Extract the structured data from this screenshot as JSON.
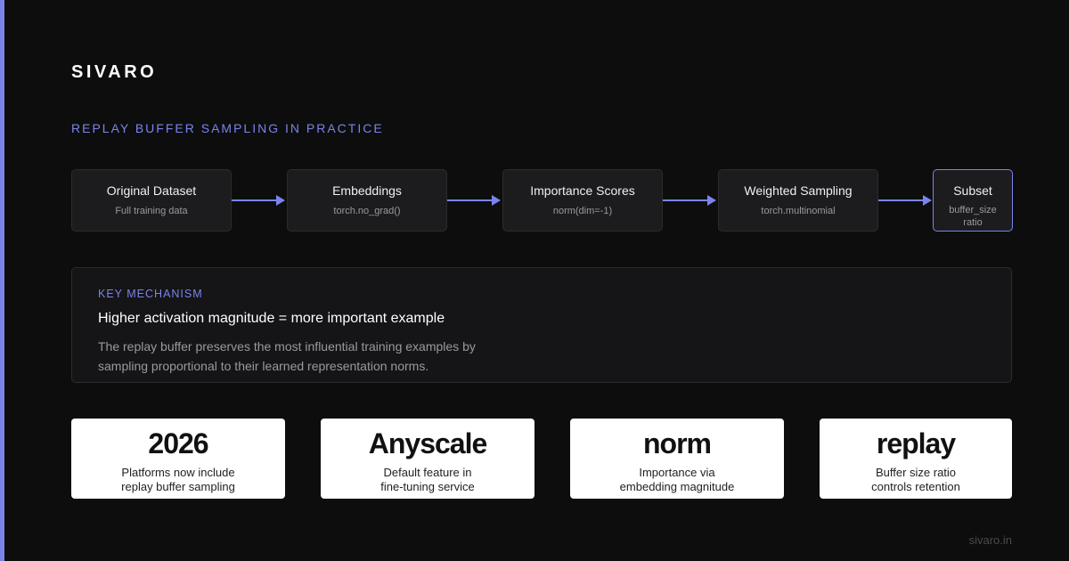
{
  "brand": "SIVARO",
  "section_label": "REPLAY BUFFER SAMPLING IN PRACTICE",
  "pipeline": [
    {
      "title": "Original Dataset",
      "subtitle": "Full training data"
    },
    {
      "title": "Embeddings",
      "subtitle": "torch.no_grad()"
    },
    {
      "title": "Importance Scores",
      "subtitle": "norm(dim=-1)"
    },
    {
      "title": "Weighted Sampling",
      "subtitle": "torch.multinomial"
    },
    {
      "title": "Subset",
      "subtitle_line1": "buffer_size",
      "subtitle_line2": "ratio"
    }
  ],
  "mechanism": {
    "kicker": "KEY MECHANISM",
    "headline": "Higher activation magnitude = more important example",
    "description": "The replay buffer preserves the most influential training examples by sampling proportional to their learned representation norms."
  },
  "stats": [
    {
      "value": "2026",
      "caption_line1": "Platforms now include",
      "caption_line2": "replay buffer sampling"
    },
    {
      "value": "Anyscale",
      "caption_line1": "Default feature in",
      "caption_line2": "fine-tuning service"
    },
    {
      "value": "norm",
      "caption_line1": "Importance via",
      "caption_line2": "embedding magnitude"
    },
    {
      "value": "replay",
      "caption_line1": "Buffer size ratio",
      "caption_line2": "controls retention"
    }
  ],
  "footer": "sivaro.in",
  "colors": {
    "accent": "#7b83eb",
    "background": "#0d0d0d",
    "card": "#1c1c1e"
  }
}
